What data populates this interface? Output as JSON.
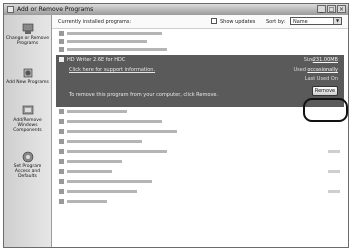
{
  "window": {
    "title": "Add or Remove Programs"
  },
  "sidebar": {
    "items": [
      {
        "label": "Change or Remove Programs",
        "icon": "change-remove-icon"
      },
      {
        "label": "Add New Programs",
        "icon": "add-programs-icon"
      },
      {
        "label": "Add/Remove Windows Components",
        "icon": "windows-components-icon"
      },
      {
        "label": "Set Program Access and Defaults",
        "icon": "program-defaults-icon"
      }
    ]
  },
  "header": {
    "installed_label": "Currently installed programs:",
    "show_updates_label": "Show updates",
    "sort_by_label": "Sort by:",
    "sort_by_value": "Name"
  },
  "selected_program": {
    "name": "HD Writer 2.6E for HDC",
    "support_link": "Click here for support information.",
    "size_label": "Size",
    "size_value": "231.00MB",
    "used_label": "Used",
    "used_value": "occasionally",
    "last_used_label": "Last Used On",
    "remove_message": "To remove this program from your computer, click Remove.",
    "remove_button": "Remove"
  }
}
